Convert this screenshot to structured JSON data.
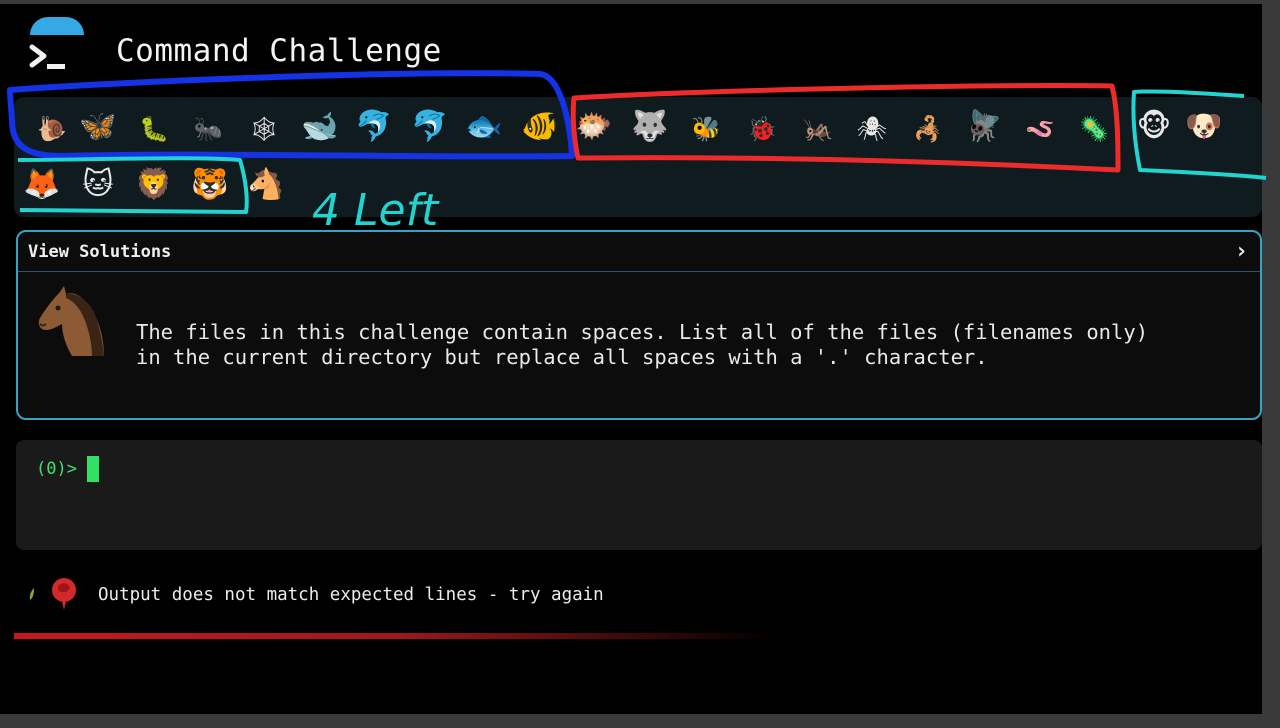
{
  "app": {
    "title": "Command Challenge"
  },
  "animals": {
    "row1": [
      "🐌",
      "🦋",
      "🐛",
      "🐜",
      "🕸",
      "🐋",
      "🐬",
      "🐬",
      "🐟",
      "🐠",
      "🐡",
      "🐺",
      "🐝",
      "🐞",
      "🦗",
      "🕷",
      "🦂",
      "🪰",
      "🪱",
      "🦠",
      "🐵",
      "🐶"
    ],
    "row2": [
      "🦊",
      "🐱",
      "🦁",
      "🐯",
      "🐴"
    ]
  },
  "annotation": {
    "note": "4 Left"
  },
  "solutions": {
    "header": "View Solutions",
    "chevron": "›",
    "icon": "horse-icon",
    "description": "The files in this challenge contain spaces. List all of the files (filenames only)\nin the current directory but replace all spaces with a '.' character."
  },
  "terminal": {
    "prompt": "(0)>"
  },
  "status": {
    "message": "Output does not match expected lines - try again",
    "icon": "rose-icon"
  },
  "colors": {
    "accent": "#3aa1c2",
    "prompt": "#3ee26a",
    "error": "#c8191c",
    "annotation_blue": "#1432e6",
    "annotation_red": "#ee2b2b",
    "annotation_cyan": "#23d3cf"
  }
}
